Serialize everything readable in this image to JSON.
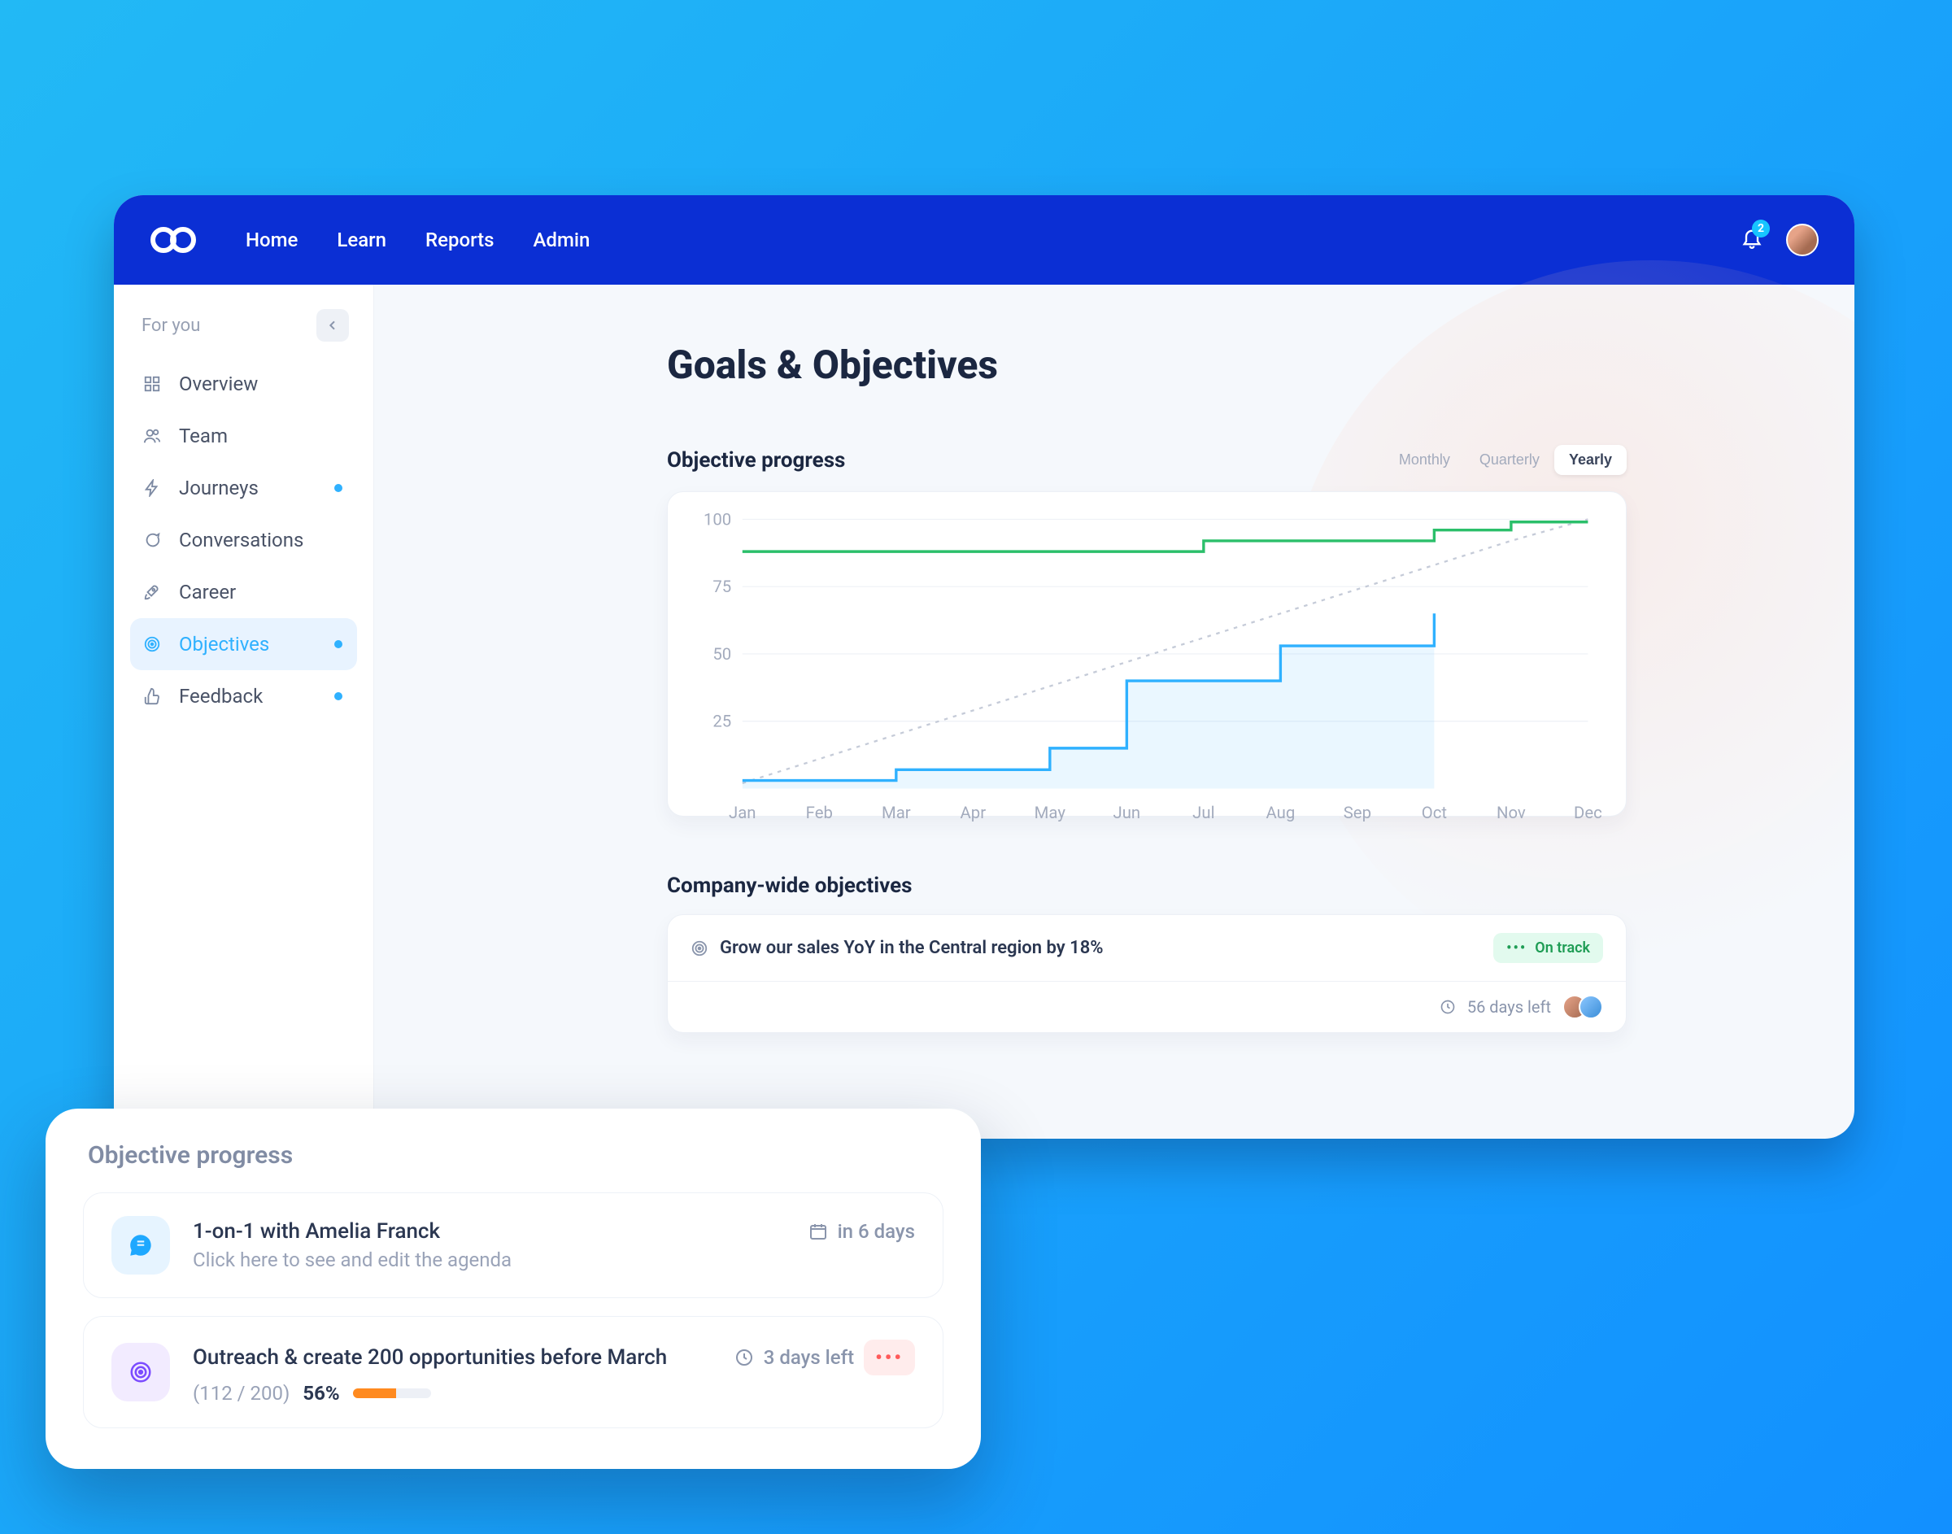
{
  "header": {
    "nav": [
      "Home",
      "Learn",
      "Reports",
      "Admin"
    ],
    "notification_count": "2"
  },
  "sidebar": {
    "section_label": "For you",
    "items": [
      {
        "label": "Overview",
        "active": false,
        "dot": false
      },
      {
        "label": "Team",
        "active": false,
        "dot": false
      },
      {
        "label": "Journeys",
        "active": false,
        "dot": true
      },
      {
        "label": "Conversations",
        "active": false,
        "dot": false
      },
      {
        "label": "Career",
        "active": false,
        "dot": false
      },
      {
        "label": "Objectives",
        "active": true,
        "dot": true
      },
      {
        "label": "Feedback",
        "active": false,
        "dot": true
      }
    ]
  },
  "page": {
    "title": "Goals & Objectives",
    "progress_section_title": "Objective progress",
    "range_options": [
      "Monthly",
      "Quarterly",
      "Yearly"
    ],
    "range_selected": "Yearly",
    "company_section_title": "Company-wide objectives"
  },
  "chart_data": {
    "type": "line",
    "categories": [
      "Jan",
      "Feb",
      "Mar",
      "Apr",
      "May",
      "Jun",
      "Jul",
      "Aug",
      "Sep",
      "Oct",
      "Nov",
      "Dec"
    ],
    "ylim": [
      0,
      100
    ],
    "yticks": [
      25,
      50,
      75,
      100
    ],
    "series": [
      {
        "name": "target",
        "style": "dash",
        "values": [
          2,
          11,
          20,
          29,
          38,
          47,
          56,
          65,
          74,
          83,
          92,
          100
        ]
      },
      {
        "name": "green",
        "style": "green",
        "values": [
          88,
          88,
          88,
          88,
          88,
          88,
          92,
          92,
          92,
          96,
          99,
          99
        ]
      },
      {
        "name": "blue",
        "style": "blue",
        "values": [
          3,
          3,
          7,
          7,
          15,
          40,
          40,
          53,
          53,
          65,
          null,
          null
        ]
      }
    ]
  },
  "company_objective": {
    "title": "Grow our sales YoY in the Central region by 18%",
    "status_label": "On track",
    "days_left": "56 days left"
  },
  "widget": {
    "title": "Objective progress",
    "cards": [
      {
        "type": "meeting",
        "title": "1-on-1 with Amelia Franck",
        "subtitle": "Click here to see and edit the agenda",
        "time_label": "in 6 days"
      },
      {
        "type": "objective",
        "title": "Outreach & create 200 opportunities before March",
        "time_label": "3 days left",
        "count_label": "(112 / 200)",
        "pct_label": "56%",
        "pct": 56
      }
    ]
  },
  "colors": {
    "accent": "#2fb1ff",
    "green": "#2bbf6a",
    "orange": "#ff8a1f"
  }
}
